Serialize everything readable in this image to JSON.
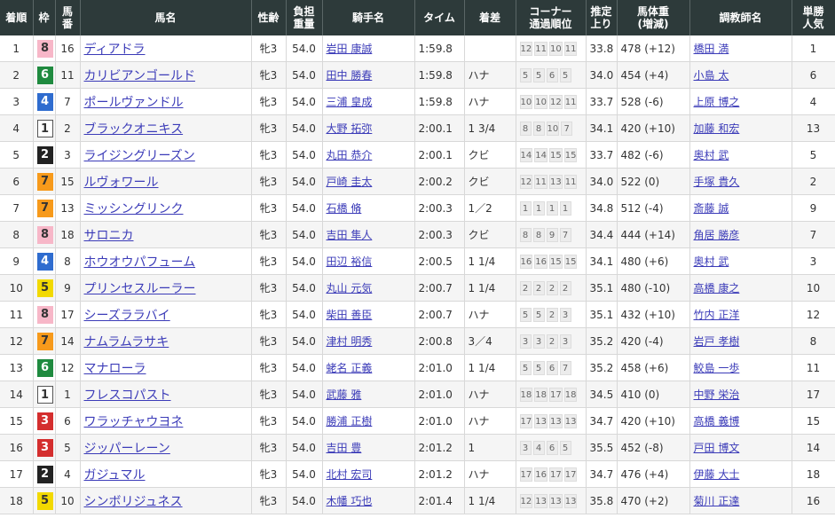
{
  "headers": [
    "着順",
    "枠",
    "馬\n番",
    "馬名",
    "性齢",
    "負担\n重量",
    "騎手名",
    "タイム",
    "着差",
    "コーナー\n通過順位",
    "推定\n上り",
    "馬体重\n(増減)",
    "調教師名",
    "単勝\n人気"
  ],
  "rows": [
    {
      "rank": "1",
      "waku": "8",
      "umaban": "16",
      "horse": "ディアドラ",
      "sexage": "牝3",
      "weight": "54.0",
      "jockey": "岩田 康誠",
      "time": "1:59.8",
      "margin": "",
      "corners": [
        "12",
        "11",
        "10",
        "11"
      ],
      "last3f": "33.8",
      "bodyweight": "478 (+12)",
      "trainer": "橋田 満",
      "pop": "1"
    },
    {
      "rank": "2",
      "waku": "6",
      "umaban": "11",
      "horse": "カリビアンゴールド",
      "sexage": "牝3",
      "weight": "54.0",
      "jockey": "田中 勝春",
      "time": "1:59.8",
      "margin": "ハナ",
      "corners": [
        "5",
        "5",
        "6",
        "5"
      ],
      "last3f": "34.0",
      "bodyweight": "454 (+4)",
      "trainer": "小島 太",
      "pop": "6"
    },
    {
      "rank": "3",
      "waku": "4",
      "umaban": "7",
      "horse": "ポールヴァンドル",
      "sexage": "牝3",
      "weight": "54.0",
      "jockey": "三浦 皇成",
      "time": "1:59.8",
      "margin": "ハナ",
      "corners": [
        "10",
        "10",
        "12",
        "11"
      ],
      "last3f": "33.7",
      "bodyweight": "528 (-6)",
      "trainer": "上原 博之",
      "pop": "4"
    },
    {
      "rank": "4",
      "waku": "1",
      "umaban": "2",
      "horse": "ブラックオニキス",
      "sexage": "牝3",
      "weight": "54.0",
      "jockey": "大野 拓弥",
      "time": "2:00.1",
      "margin": "1 3/4",
      "corners": [
        "8",
        "8",
        "10",
        "7"
      ],
      "last3f": "34.1",
      "bodyweight": "420 (+10)",
      "trainer": "加藤 和宏",
      "pop": "13"
    },
    {
      "rank": "5",
      "waku": "2",
      "umaban": "3",
      "horse": "ライジングリーズン",
      "sexage": "牝3",
      "weight": "54.0",
      "jockey": "丸田 恭介",
      "time": "2:00.1",
      "margin": "クビ",
      "corners": [
        "14",
        "14",
        "15",
        "15"
      ],
      "last3f": "33.7",
      "bodyweight": "482 (-6)",
      "trainer": "奥村 武",
      "pop": "5"
    },
    {
      "rank": "6",
      "waku": "7",
      "umaban": "15",
      "horse": "ルヴォワール",
      "sexage": "牝3",
      "weight": "54.0",
      "jockey": "戸崎 圭太",
      "time": "2:00.2",
      "margin": "クビ",
      "corners": [
        "12",
        "11",
        "13",
        "11"
      ],
      "last3f": "34.0",
      "bodyweight": "522 (0)",
      "trainer": "手塚 貴久",
      "pop": "2"
    },
    {
      "rank": "7",
      "waku": "7",
      "umaban": "13",
      "horse": "ミッシングリンク",
      "sexage": "牝3",
      "weight": "54.0",
      "jockey": "石橋 脩",
      "time": "2:00.3",
      "margin": "1／2",
      "corners": [
        "1",
        "1",
        "1",
        "1"
      ],
      "last3f": "34.8",
      "bodyweight": "512 (-4)",
      "trainer": "斎藤 誠",
      "pop": "9"
    },
    {
      "rank": "8",
      "waku": "8",
      "umaban": "18",
      "horse": "サロニカ",
      "sexage": "牝3",
      "weight": "54.0",
      "jockey": "吉田 隼人",
      "time": "2:00.3",
      "margin": "クビ",
      "corners": [
        "8",
        "8",
        "9",
        "7"
      ],
      "last3f": "34.4",
      "bodyweight": "444 (+14)",
      "trainer": "角居 勝彦",
      "pop": "7"
    },
    {
      "rank": "9",
      "waku": "4",
      "umaban": "8",
      "horse": "ホウオウパフューム",
      "sexage": "牝3",
      "weight": "54.0",
      "jockey": "田辺 裕信",
      "time": "2:00.5",
      "margin": "1 1/4",
      "corners": [
        "16",
        "16",
        "15",
        "15"
      ],
      "last3f": "34.1",
      "bodyweight": "480 (+6)",
      "trainer": "奥村 武",
      "pop": "3"
    },
    {
      "rank": "10",
      "waku": "5",
      "umaban": "9",
      "horse": "プリンセスルーラー",
      "sexage": "牝3",
      "weight": "54.0",
      "jockey": "丸山 元気",
      "time": "2:00.7",
      "margin": "1 1/4",
      "corners": [
        "2",
        "2",
        "2",
        "2"
      ],
      "last3f": "35.1",
      "bodyweight": "480 (-10)",
      "trainer": "高橋 康之",
      "pop": "10"
    },
    {
      "rank": "11",
      "waku": "8",
      "umaban": "17",
      "horse": "シーズララバイ",
      "sexage": "牝3",
      "weight": "54.0",
      "jockey": "柴田 善臣",
      "time": "2:00.7",
      "margin": "ハナ",
      "corners": [
        "5",
        "5",
        "2",
        "3"
      ],
      "last3f": "35.1",
      "bodyweight": "432 (+10)",
      "trainer": "竹内 正洋",
      "pop": "12"
    },
    {
      "rank": "12",
      "waku": "7",
      "umaban": "14",
      "horse": "ナムラムラサキ",
      "sexage": "牝3",
      "weight": "54.0",
      "jockey": "津村 明秀",
      "time": "2:00.8",
      "margin": "3／4",
      "corners": [
        "3",
        "3",
        "2",
        "3"
      ],
      "last3f": "35.2",
      "bodyweight": "420 (-4)",
      "trainer": "岩戸 孝樹",
      "pop": "8"
    },
    {
      "rank": "13",
      "waku": "6",
      "umaban": "12",
      "horse": "マナローラ",
      "sexage": "牝3",
      "weight": "54.0",
      "jockey": "蛯名 正義",
      "time": "2:01.0",
      "margin": "1 1/4",
      "corners": [
        "5",
        "5",
        "6",
        "7"
      ],
      "last3f": "35.2",
      "bodyweight": "458 (+6)",
      "trainer": "鮫島 一歩",
      "pop": "11"
    },
    {
      "rank": "14",
      "waku": "1",
      "umaban": "1",
      "horse": "フレスコパスト",
      "sexage": "牝3",
      "weight": "54.0",
      "jockey": "武藤 雅",
      "time": "2:01.0",
      "margin": "ハナ",
      "corners": [
        "18",
        "18",
        "17",
        "18"
      ],
      "last3f": "34.5",
      "bodyweight": "410 (0)",
      "trainer": "中野 栄治",
      "pop": "17"
    },
    {
      "rank": "15",
      "waku": "3",
      "umaban": "6",
      "horse": "ワラッチャウヨネ",
      "sexage": "牝3",
      "weight": "54.0",
      "jockey": "勝浦 正樹",
      "time": "2:01.0",
      "margin": "ハナ",
      "corners": [
        "17",
        "13",
        "13",
        "13"
      ],
      "last3f": "34.7",
      "bodyweight": "420 (+10)",
      "trainer": "高橋 義博",
      "pop": "15"
    },
    {
      "rank": "16",
      "waku": "3",
      "umaban": "5",
      "horse": "ジッパーレーン",
      "sexage": "牝3",
      "weight": "54.0",
      "jockey": "吉田 豊",
      "time": "2:01.2",
      "margin": "1",
      "corners": [
        "3",
        "4",
        "6",
        "5"
      ],
      "last3f": "35.5",
      "bodyweight": "452 (-8)",
      "trainer": "戸田 博文",
      "pop": "14"
    },
    {
      "rank": "17",
      "waku": "2",
      "umaban": "4",
      "horse": "ガジュマル",
      "sexage": "牝3",
      "weight": "54.0",
      "jockey": "北村 宏司",
      "time": "2:01.2",
      "margin": "ハナ",
      "corners": [
        "17",
        "16",
        "17",
        "17"
      ],
      "last3f": "34.7",
      "bodyweight": "476 (+4)",
      "trainer": "伊藤 大士",
      "pop": "18"
    },
    {
      "rank": "18",
      "waku": "5",
      "umaban": "10",
      "horse": "シンボリジュネス",
      "sexage": "牝3",
      "weight": "54.0",
      "jockey": "木幡 巧也",
      "time": "2:01.4",
      "margin": "1 1/4",
      "corners": [
        "12",
        "13",
        "13",
        "13"
      ],
      "last3f": "35.8",
      "bodyweight": "470 (+2)",
      "trainer": "菊川 正達",
      "pop": "16"
    }
  ]
}
